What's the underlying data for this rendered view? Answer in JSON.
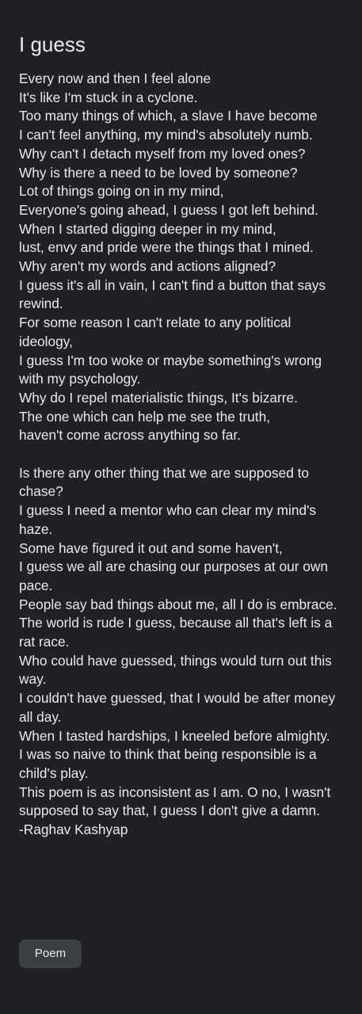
{
  "note": {
    "title": "I guess",
    "lines": [
      "Every now and then I feel alone",
      "It's like I'm stuck in a cyclone.",
      "Too many things of which, a slave I have become",
      "I can't feel anything, my mind's absolutely numb.",
      "Why can't I detach myself from my loved ones?",
      "Why is there a need to be loved by someone?",
      "Lot of things going on in my mind,",
      "Everyone's going ahead, I guess I got left behind.",
      "When I started digging deeper in my mind,",
      "lust, envy and pride were the things that I mined.",
      "Why aren't my words and actions aligned?",
      "I guess it's all in vain, I can't find a button that says rewind.",
      "For some reason I can't relate to any political ideology,",
      "I guess I'm too woke or maybe something's wrong with my psychology.",
      "Why do I repel materialistic things, It's bizarre.",
      "The one which can help me see the truth,",
      "haven't come across anything so far.",
      "",
      "Is there any other thing that we are supposed to chase?",
      "I guess I need a mentor who can clear my mind's haze.",
      "Some have figured it out and some haven't,",
      "I guess we all are chasing our purposes at our own pace.",
      "People say bad things about me, all I do is embrace.",
      "The world is rude I guess, because all that's left is a rat race.",
      "Who could have guessed, things would turn out this way.",
      "I couldn't have guessed, that I would be after money all day.",
      "When I tasted hardships, I kneeled before almighty.",
      "I was so naive to think that being responsible is a child's play.",
      "This poem is as inconsistent as I am. O no, I wasn't supposed to say that, I guess I don't give a damn.",
      "-Raghav Kashyap"
    ]
  },
  "labels": [
    "Poem"
  ]
}
